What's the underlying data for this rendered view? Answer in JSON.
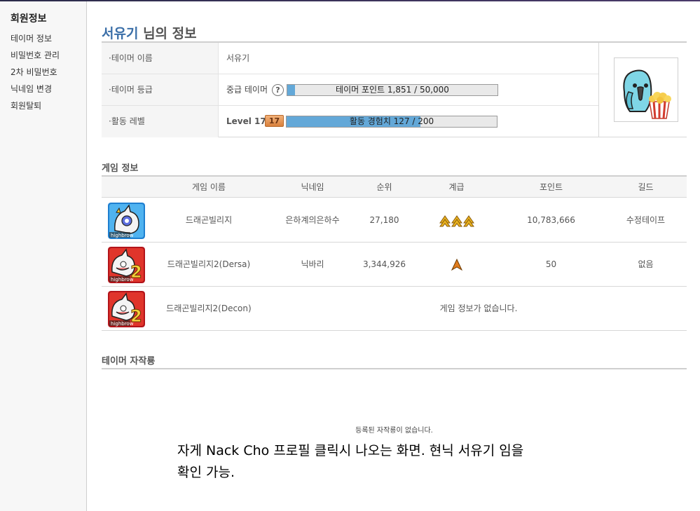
{
  "sidebar": {
    "title": "회원정보",
    "items": [
      {
        "label": "테이머 정보"
      },
      {
        "label": "비밀번호 관리"
      },
      {
        "label": "2차 비밀번호"
      },
      {
        "label": "닉네임 변경"
      },
      {
        "label": "회원탈퇴"
      }
    ]
  },
  "header": {
    "name": "서유기",
    "suffix": " 님의 정보"
  },
  "profile": {
    "rows": {
      "name_label": "·테이머 이름",
      "name_value": "서유기",
      "grade_label": "·테이머 등급",
      "grade_value": "중급 테이머",
      "help_icon": "?",
      "points_text": "테이머 포인트 1,851 / 50,000",
      "points_current": 1851,
      "points_max": 50000,
      "level_label": "·활동 레벨",
      "level_text": "Level 17",
      "level_badge": "17",
      "exp_text": "활동 경험치 127 / 200",
      "exp_current": 127,
      "exp_max": 200
    },
    "avatar": "parrot-with-popcorn"
  },
  "games_section": {
    "title": "게임 정보",
    "columns": [
      "게임 이름",
      "닉네임",
      "순위",
      "계급",
      "포인트",
      "길드"
    ],
    "rows": [
      {
        "icon": "dragon-village-icon",
        "name": "드래곤빌리지",
        "nickname": "은하계의은하수",
        "rank": "27,180",
        "grade_icons": 3,
        "points": "10,783,666",
        "guild": "수정테이프",
        "no_info": ""
      },
      {
        "icon": "dragon-village-2-icon",
        "name": "드래곤빌리지2(Dersa)",
        "nickname": "닉바리",
        "rank": "3,344,926",
        "grade_icons": 1,
        "points": "50",
        "guild": "없음",
        "no_info": ""
      },
      {
        "icon": "dragon-village-2-icon",
        "name": "드래곤빌리지2(Decon)",
        "nickname": "",
        "rank": "",
        "grade_icons": 0,
        "points": "",
        "guild": "",
        "no_info": "게임 정보가 없습니다."
      }
    ]
  },
  "creations_section": {
    "title": "테이머 자작룡",
    "empty_text": "등록된 자작룡이 없습니다."
  },
  "caption": {
    "line1": "자게 Nack Cho 프로필 클릭시 나오는 화면. 현닉 서유기 임을",
    "line2": "확인 가능."
  },
  "colors": {
    "title_name": "#3b6fa8",
    "bar_fill": "#63a8d8",
    "rank_gold": "#e8b21e",
    "rank_orange": "#e07b1c"
  }
}
